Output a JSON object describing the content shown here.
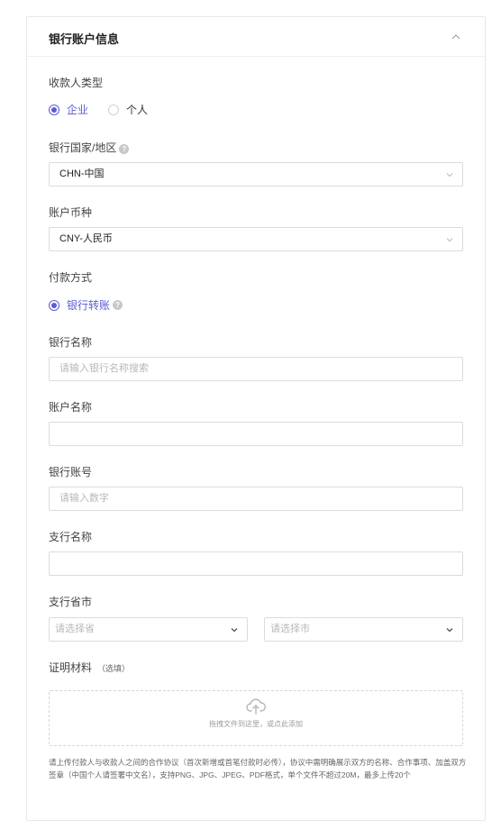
{
  "section": {
    "title": "银行账户信息"
  },
  "payee_type": {
    "label": "收款人类型",
    "options": [
      {
        "label": "企业",
        "selected": true
      },
      {
        "label": "个人",
        "selected": false
      }
    ]
  },
  "bank_country": {
    "label": "银行国家/地区",
    "value": "CHN-中国"
  },
  "currency": {
    "label": "账户币种",
    "value": "CNY-人民币"
  },
  "payment_method": {
    "label": "付款方式",
    "option": "银行转账"
  },
  "bank_name": {
    "label": "银行名称",
    "placeholder": "请输入银行名称搜索"
  },
  "account_name": {
    "label": "账户名称",
    "value": ""
  },
  "account_number": {
    "label": "银行账号",
    "placeholder": "请输入数字"
  },
  "branch_name": {
    "label": "支行名称",
    "value": ""
  },
  "branch_location": {
    "label": "支行省市",
    "province_placeholder": "请选择省",
    "city_placeholder": "请选择市"
  },
  "proof": {
    "label": "证明材料",
    "optional": "（选填）",
    "upload_text": "拖拽文件到这里，或点此添加",
    "note": "请上传付款人与收款人之间的合作协议（首次新增或首笔付款时必传），协议中需明确展示双方的名称、合作事项、加盖双方签章（中国个人请签署中文名），支持PNG、JPG、JPEG、PDF格式，单个文件不超过20M，最多上传20个"
  },
  "colors": {
    "accent": "#5b5bd6",
    "border": "#dcdce0",
    "placeholder": "#b8b8bd"
  },
  "icons": [
    "chevron-up-icon",
    "help-icon",
    "chevron-down-icon",
    "upload-cloud-icon"
  ]
}
